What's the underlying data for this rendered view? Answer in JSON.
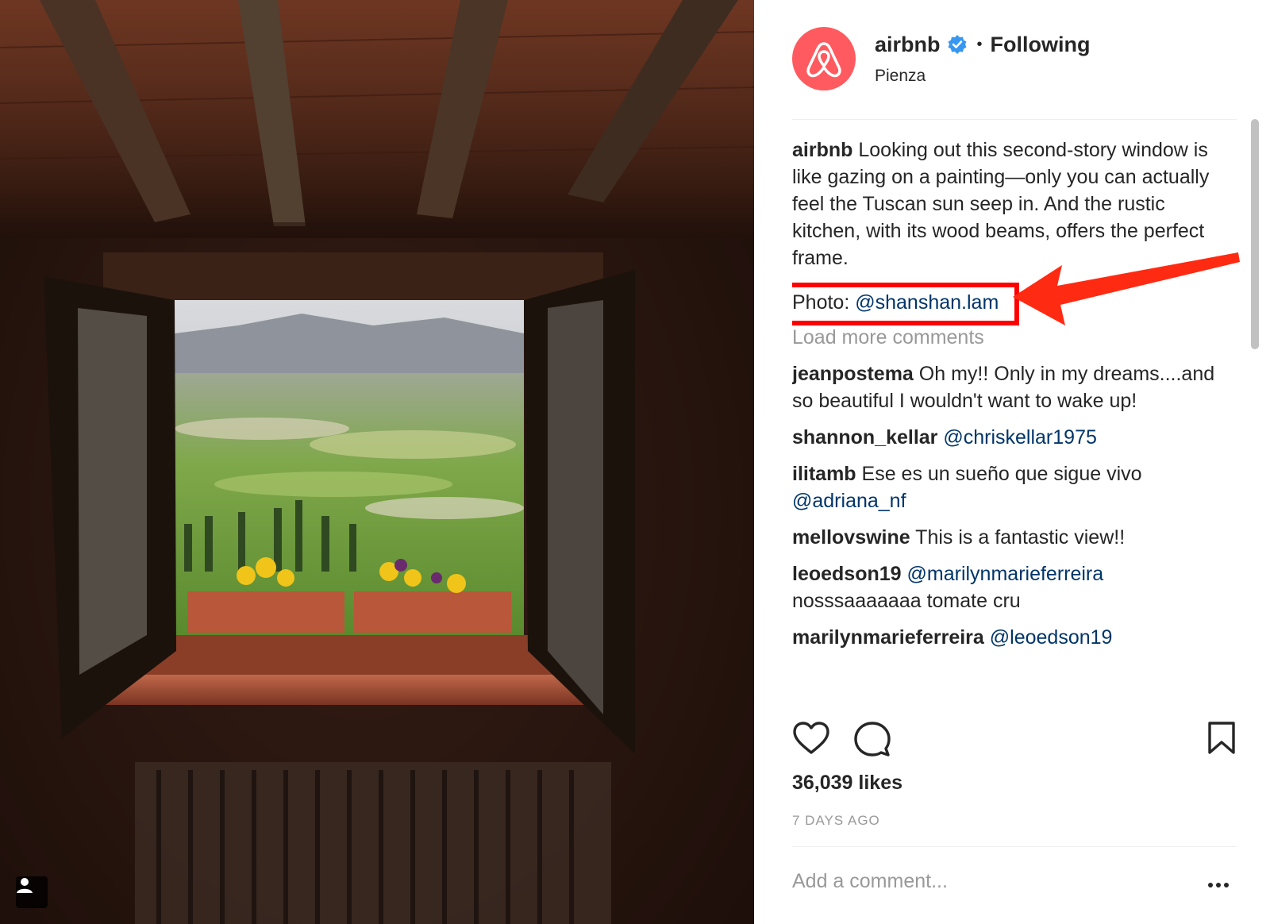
{
  "post": {
    "username": "airbnb",
    "separator": "•",
    "follow_status": "Following",
    "location": "Pienza"
  },
  "caption": {
    "username": "airbnb",
    "text": "Looking out this second-story window is like gazing on a painting—only you can actually feel the Tuscan sun seep in. And the rustic kitchen, with its wood beams, offers the perfect frame.",
    "photo_credit_label": "Photo:",
    "photo_credit_handle": "@shanshan.lam"
  },
  "load_more_label": "Load more comments",
  "comments": [
    {
      "username": "jeanpostema",
      "text": "Oh my!! Only in my dreams....and so beautiful I wouldn't want to wake up!",
      "mention": ""
    },
    {
      "username": "shannon_kellar",
      "text": "",
      "mention": "@chriskellar1975"
    },
    {
      "username": "ilitamb",
      "text": "Ese es un sueño que sigue vivo",
      "mention": "@adriana_nf"
    },
    {
      "username": "mellovswine",
      "text": "This is a fantastic view!!",
      "mention": ""
    },
    {
      "username": "leoedson19",
      "text": "nosssaaaaaaa tomate cru",
      "mention": "@marilynmarieferreira"
    },
    {
      "username": "marilynmarieferreira",
      "text": "",
      "mention": "@leoedson19"
    }
  ],
  "likes": "36,039 likes",
  "time_ago": "7 DAYS AGO",
  "add_comment_placeholder": "Add a comment...",
  "icons": {
    "like": "heart-icon",
    "comment": "comment-bubble-icon",
    "save": "bookmark-icon",
    "more": "more-options-icon",
    "verified": "verified-badge-icon",
    "user_tag": "user-tag-icon"
  },
  "colors": {
    "brand": "#ff5a5f",
    "verified": "#3897f0",
    "link": "#003569",
    "annotation": "#ff0000",
    "muted": "#999999"
  }
}
